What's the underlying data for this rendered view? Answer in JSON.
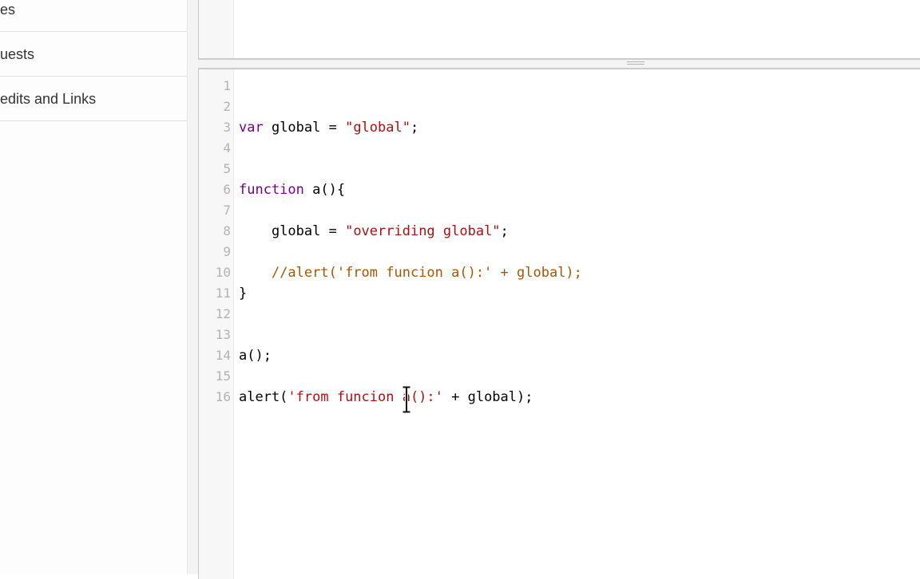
{
  "sidebar": {
    "items": [
      {
        "label": "es"
      },
      {
        "label": "uests"
      },
      {
        "label": "edits and Links"
      }
    ]
  },
  "editor": {
    "line_numbers": [
      "1",
      "2",
      "3",
      "4",
      "5",
      "6",
      "7",
      "8",
      "9",
      "10",
      "11",
      "12",
      "13",
      "14",
      "15",
      "16"
    ],
    "code": {
      "l3": {
        "kw": "var",
        "rest": " global = ",
        "str": "\"global\"",
        "end": ";"
      },
      "l6": {
        "kw": "function",
        "rest": " a(){"
      },
      "l8": {
        "indent": "    ",
        "rest": "global = ",
        "str": "\"overriding global\"",
        "end": ";"
      },
      "l10": {
        "indent": "    ",
        "cmt": "//alert('from funcion a():' + global);"
      },
      "l11": {
        "rest": "}"
      },
      "l14": {
        "rest": "a();"
      },
      "l16": {
        "pre": "alert(",
        "str": "'from funcion a():'",
        "rest": " + global);"
      }
    }
  },
  "colors": {
    "keyword": "#770088",
    "string": "#aa1111",
    "comment": "#aa5500"
  }
}
